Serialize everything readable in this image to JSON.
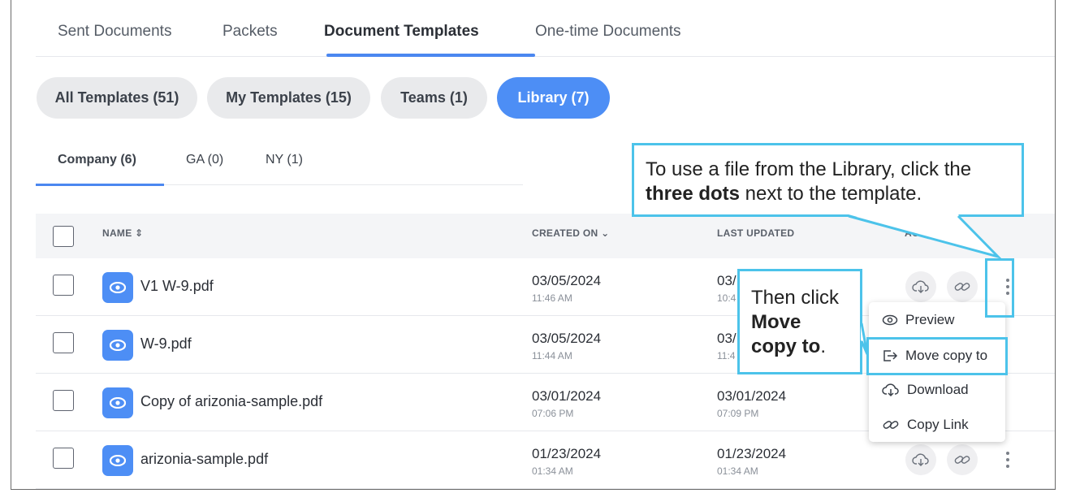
{
  "top_tabs": [
    {
      "label": "Sent Documents"
    },
    {
      "label": "Packets"
    },
    {
      "label": "Document Templates"
    },
    {
      "label": "One-time Documents"
    }
  ],
  "filters": [
    {
      "label": "All Templates (51)"
    },
    {
      "label": "My Templates (15)"
    },
    {
      "label": "Teams (1)"
    },
    {
      "label": "Library (7)"
    }
  ],
  "sub_tabs": [
    {
      "label": "Company (6)"
    },
    {
      "label": "GA (0)"
    },
    {
      "label": "NY (1)"
    }
  ],
  "table": {
    "headers": {
      "name": "NAME ⇕",
      "created": "CREATED ON ⌄",
      "updated": "LAST UPDATED",
      "actions": "AC"
    },
    "rows": [
      {
        "name": "V1 W-9.pdf",
        "created_date": "03/05/2024",
        "created_time": "11:46 AM",
        "updated_date": "03/",
        "updated_time": "10:4"
      },
      {
        "name": "W-9.pdf",
        "created_date": "03/05/2024",
        "created_time": "11:44 AM",
        "updated_date": "03/",
        "updated_time": "11:4"
      },
      {
        "name": "Copy of arizonia-sample.pdf",
        "created_date": "03/01/2024",
        "created_time": "07:06 PM",
        "updated_date": "03/01/2024",
        "updated_time": "07:09 PM"
      },
      {
        "name": "arizonia-sample.pdf",
        "created_date": "01/23/2024",
        "created_time": "01:34 AM",
        "updated_date": "01/23/2024",
        "updated_time": "01:34 AM"
      }
    ]
  },
  "menu": {
    "items": [
      {
        "label": "Preview",
        "icon": "eye-icon"
      },
      {
        "label": "Move copy to",
        "icon": "move-copy-icon"
      },
      {
        "label": "Download",
        "icon": "cloud-download-icon"
      },
      {
        "label": "Copy Link",
        "icon": "link-icon"
      }
    ]
  },
  "callouts": {
    "main": {
      "text_1": "To use a file from the Library, click the ",
      "bold": "three dots",
      "text_2": " next to the template."
    },
    "small": {
      "text_1": "Then click ",
      "bold": "Move copy to",
      "text_2": "."
    }
  },
  "colors": {
    "accent": "#4d8ef5",
    "callout_border": "#4cc3ea",
    "pill_bg": "#e9eaec"
  }
}
